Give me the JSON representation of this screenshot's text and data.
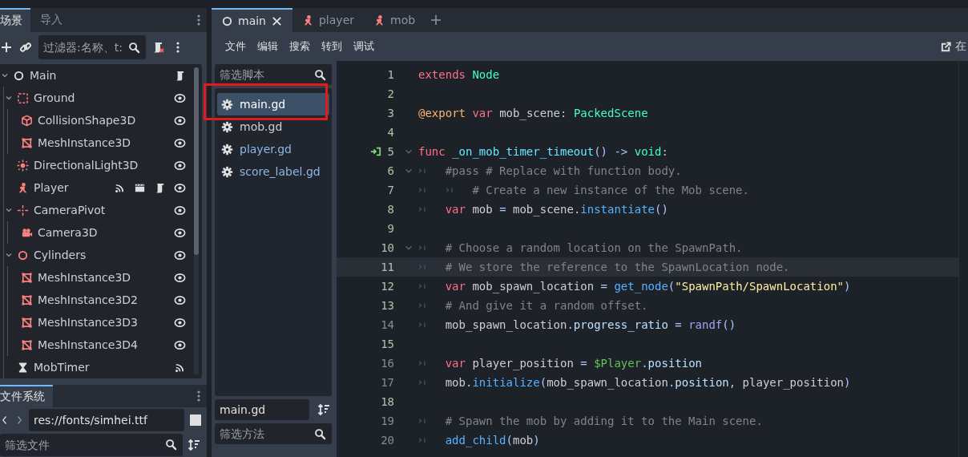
{
  "scene_dock": {
    "tabs": [
      {
        "label": "场景",
        "selected": true
      },
      {
        "label": "导入",
        "selected": false
      }
    ],
    "filter": {
      "placeholder": "过滤器:名称、t:"
    },
    "tree": [
      {
        "name": "Main",
        "kind": "node",
        "expanded": true,
        "badges": [
          {
            "kind": "script"
          }
        ],
        "children": [
          {
            "name": "Ground",
            "kind": "body",
            "expanded": true,
            "badges": [
              {
                "kind": "eye"
              }
            ],
            "children": [
              {
                "name": "CollisionShape3D",
                "kind": "cube",
                "badges": [
                  {
                    "kind": "eye"
                  }
                ]
              },
              {
                "name": "MeshInstance3D",
                "kind": "mesh",
                "badges": [
                  {
                    "kind": "eye"
                  }
                ]
              }
            ]
          },
          {
            "name": "DirectionalLight3D",
            "kind": "light",
            "badges": [
              {
                "kind": "eye"
              }
            ]
          },
          {
            "name": "Player",
            "kind": "figure",
            "badges": [
              {
                "kind": "signal"
              },
              {
                "kind": "clapper"
              },
              {
                "kind": "script"
              },
              {
                "kind": "eye"
              }
            ]
          },
          {
            "name": "CameraPivot",
            "kind": "pivot",
            "expanded": true,
            "badges": [
              {
                "kind": "eye"
              }
            ],
            "children": [
              {
                "name": "Camera3D",
                "kind": "camera",
                "badges": [
                  {
                    "kind": "eye"
                  }
                ]
              }
            ]
          },
          {
            "name": "Cylinders",
            "kind": "ring",
            "expanded": true,
            "badges": [
              {
                "kind": "eye"
              }
            ],
            "children": [
              {
                "name": "MeshInstance3D",
                "kind": "mesh",
                "badges": [
                  {
                    "kind": "eye"
                  }
                ]
              },
              {
                "name": "MeshInstance3D2",
                "kind": "mesh",
                "badges": [
                  {
                    "kind": "eye"
                  }
                ]
              },
              {
                "name": "MeshInstance3D3",
                "kind": "mesh",
                "badges": [
                  {
                    "kind": "eye"
                  }
                ]
              },
              {
                "name": "MeshInstance3D4",
                "kind": "mesh",
                "badges": [
                  {
                    "kind": "eye"
                  }
                ]
              }
            ]
          },
          {
            "name": "MobTimer",
            "kind": "hourglass",
            "badges": [
              {
                "kind": "signal"
              }
            ]
          }
        ]
      }
    ]
  },
  "filesystem_dock": {
    "tabs": [
      {
        "label": "文件系统",
        "selected": true
      }
    ],
    "path": "res://fonts/simhei.ttf",
    "filter": {
      "placeholder": "筛选文件"
    }
  },
  "editor_tabs": [
    {
      "label": "main",
      "kind": "node",
      "selected": true
    },
    {
      "label": "player",
      "kind": "figure",
      "selected": false
    },
    {
      "label": "mob",
      "kind": "figure",
      "selected": false
    }
  ],
  "menu": [
    "文件",
    "编辑",
    "搜索",
    "转到",
    "调试"
  ],
  "online_docs": "在",
  "scripts": {
    "filter": {
      "placeholder": "筛选脚本"
    },
    "items": [
      {
        "name": "main.gd",
        "selected": true,
        "outlined": true,
        "color": "#ffffff"
      },
      {
        "name": "mob.gd",
        "selected": false,
        "outlined": false,
        "color": "#cdcfd2"
      },
      {
        "name": "player.gd",
        "selected": false,
        "outlined": false,
        "color": "#8ab8e8"
      },
      {
        "name": "score_label.gd",
        "selected": false,
        "outlined": false,
        "color": "#8ab8e8"
      }
    ],
    "current": "main.gd",
    "method_filter": {
      "placeholder": "筛选方法"
    }
  },
  "code": [
    {
      "number": "1",
      "changed": true,
      "tokens": [
        {
          "kind": "kw",
          "text": "extends"
        },
        {
          "kind": "type",
          "text": " Node"
        }
      ]
    },
    {
      "number": "2",
      "changed": true
    },
    {
      "number": "3",
      "changed": true,
      "tokens": [
        {
          "kind": "annot",
          "text": "@export"
        },
        {
          "kind": "kw",
          "text": " var"
        },
        {
          "kind": "text",
          "text": " mob_scene"
        },
        {
          "kind": "symbol",
          "text": ":"
        },
        {
          "kind": "type",
          "text": " PackedScene"
        }
      ]
    },
    {
      "number": "4",
      "changed": true
    },
    {
      "number": "5",
      "changed": true,
      "connected": true,
      "expanded": true,
      "tokens": [
        {
          "kind": "kw",
          "text": "func"
        },
        {
          "kind": "fndef",
          "text": " _on_mob_timer_timeout"
        },
        {
          "kind": "symbol",
          "text": "() ->"
        },
        {
          "kind": "type",
          "text": " void"
        },
        {
          "kind": "symbol",
          "text": ":"
        }
      ]
    },
    {
      "number": "6",
      "changed": true,
      "expanded": true,
      "indent": [
        {
          "kind": "tab"
        }
      ],
      "tokens": [
        {
          "kind": "comment",
          "text": "#pass # Replace with function body."
        }
      ]
    },
    {
      "number": "7",
      "changed": true,
      "indent": [
        {
          "kind": "tab"
        },
        {
          "kind": "tab"
        }
      ],
      "tokens": [
        {
          "kind": "comment",
          "text": "# Create a new instance of the Mob scene."
        }
      ]
    },
    {
      "number": "8",
      "changed": true,
      "indent": [
        {
          "kind": "tab"
        }
      ],
      "tokens": [
        {
          "kind": "kw",
          "text": "var"
        },
        {
          "kind": "text",
          "text": " mob "
        },
        {
          "kind": "symbol",
          "text": "="
        },
        {
          "kind": "text",
          "text": " mob_scene"
        },
        {
          "kind": "symbol",
          "text": "."
        },
        {
          "kind": "call",
          "text": "instantiate"
        },
        {
          "kind": "symbol",
          "text": "()"
        }
      ]
    },
    {
      "number": "9",
      "changed": true
    },
    {
      "number": "10",
      "changed": true,
      "expanded": true,
      "indent": [
        {
          "kind": "tab"
        }
      ],
      "tokens": [
        {
          "kind": "comment",
          "text": "# Choose a random location on the SpawnPath."
        }
      ]
    },
    {
      "number": "11",
      "changed": true,
      "current": true,
      "indent": [
        {
          "kind": "tab"
        }
      ],
      "tokens": [
        {
          "kind": "comment",
          "text": "# We store the reference to the SpawnLocation node."
        }
      ]
    },
    {
      "number": "12",
      "changed": true,
      "indent": [
        {
          "kind": "tab"
        }
      ],
      "tokens": [
        {
          "kind": "kw",
          "text": "var"
        },
        {
          "kind": "text",
          "text": " mob_spawn_location "
        },
        {
          "kind": "symbol",
          "text": "="
        },
        {
          "kind": "call",
          "text": " get_node"
        },
        {
          "kind": "symbol",
          "text": "("
        },
        {
          "kind": "string",
          "text": "\"SpawnPath/SpawnLocation\""
        },
        {
          "kind": "symbol",
          "text": ")"
        }
      ]
    },
    {
      "number": "13",
      "changed": true,
      "indent": [
        {
          "kind": "tab"
        }
      ],
      "tokens": [
        {
          "kind": "comment",
          "text": "# And give it a random offset."
        }
      ]
    },
    {
      "number": "14",
      "changed": false,
      "indent": [
        {
          "kind": "tab"
        }
      ],
      "tokens": [
        {
          "kind": "text",
          "text": "mob_spawn_location"
        },
        {
          "kind": "symbol",
          "text": "."
        },
        {
          "kind": "member",
          "text": "progress_ratio"
        },
        {
          "kind": "symbol",
          "text": " = "
        },
        {
          "kind": "builtin",
          "text": "randf"
        },
        {
          "kind": "symbol",
          "text": "()"
        }
      ]
    },
    {
      "number": "15",
      "changed": true
    },
    {
      "number": "16",
      "changed": false,
      "indent": [
        {
          "kind": "tab"
        }
      ],
      "tokens": [
        {
          "kind": "kw",
          "text": "var"
        },
        {
          "kind": "text",
          "text": " player_position "
        },
        {
          "kind": "symbol",
          "text": "="
        },
        {
          "kind": "nodepath",
          "text": " $Player"
        },
        {
          "kind": "symbol",
          "text": "."
        },
        {
          "kind": "member",
          "text": "position"
        }
      ]
    },
    {
      "number": "17",
      "changed": false,
      "indent": [
        {
          "kind": "tab"
        }
      ],
      "tokens": [
        {
          "kind": "text",
          "text": "mob"
        },
        {
          "kind": "symbol",
          "text": "."
        },
        {
          "kind": "call",
          "text": "initialize"
        },
        {
          "kind": "symbol",
          "text": "("
        },
        {
          "kind": "text",
          "text": "mob_spawn_location"
        },
        {
          "kind": "symbol",
          "text": "."
        },
        {
          "kind": "member",
          "text": "position"
        },
        {
          "kind": "symbol",
          "text": ","
        },
        {
          "kind": "text",
          "text": " player_position"
        },
        {
          "kind": "symbol",
          "text": ")"
        }
      ]
    },
    {
      "number": "18",
      "changed": true
    },
    {
      "number": "19",
      "changed": false,
      "indent": [
        {
          "kind": "tab"
        }
      ],
      "tokens": [
        {
          "kind": "comment",
          "text": "# Spawn the mob by adding it to the Main scene."
        }
      ]
    },
    {
      "number": "20",
      "changed": false,
      "indent": [
        {
          "kind": "tab"
        }
      ],
      "tokens": [
        {
          "kind": "call",
          "text": "add_child"
        },
        {
          "kind": "symbol",
          "text": "("
        },
        {
          "kind": "text",
          "text": "mob"
        },
        {
          "kind": "symbol",
          "text": ")"
        }
      ]
    }
  ]
}
